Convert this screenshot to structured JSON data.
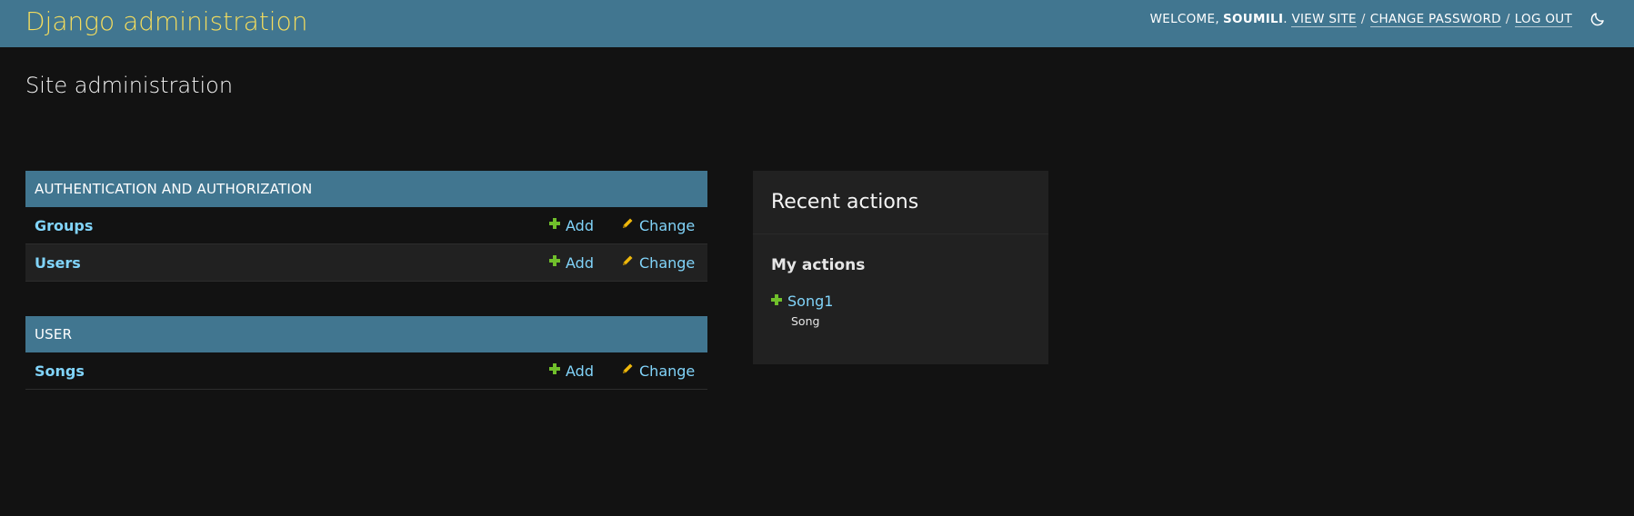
{
  "header": {
    "site_name": "Django administration",
    "welcome": "WELCOME,",
    "username": "SOUMILI",
    "view_site": "VIEW SITE",
    "change_password": "CHANGE PASSWORD",
    "log_out": "LOG OUT",
    "separator": "/",
    "theme_icon": "moon-icon"
  },
  "page": {
    "title": "Site administration"
  },
  "apps": [
    {
      "caption": "AUTHENTICATION AND AUTHORIZATION",
      "models": [
        {
          "name": "Groups",
          "add": "Add",
          "change": "Change"
        },
        {
          "name": "Users",
          "add": "Add",
          "change": "Change"
        }
      ]
    },
    {
      "caption": "USER",
      "models": [
        {
          "name": "Songs",
          "add": "Add",
          "change": "Change"
        }
      ]
    }
  ],
  "recent_actions": {
    "title": "Recent actions",
    "subtitle": "My actions",
    "items": [
      {
        "label": "Song1",
        "type": "Song",
        "icon": "plus-icon"
      }
    ]
  },
  "colors": {
    "header_bg": "#417690",
    "site_name": "#f5dd5d",
    "link": "#81d4fa",
    "add_icon": "#70bf2b",
    "change_icon": "#efb80b",
    "body_bg": "#121212"
  }
}
